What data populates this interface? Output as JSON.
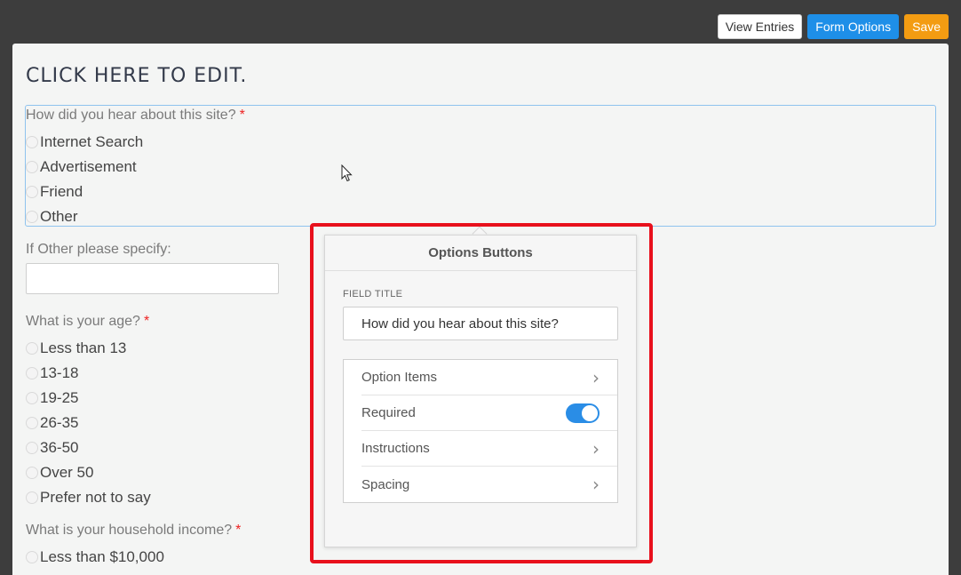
{
  "toolbar": {
    "view_entries": "View Entries",
    "form_options": "Form Options",
    "save": "Save"
  },
  "form": {
    "title": "CLICK HERE TO EDIT.",
    "required_marker": "*",
    "q1": {
      "label": "How did you hear about this site?",
      "options": [
        "Internet Search",
        "Advertisement",
        "Friend",
        "Other"
      ]
    },
    "q2": {
      "label": "If Other please specify:"
    },
    "q3": {
      "label": "What is your age?",
      "options": [
        "Less than 13",
        "13-18",
        "19-25",
        "26-35",
        "36-50",
        "Over 50",
        "Prefer not to say"
      ]
    },
    "q4": {
      "label": "What is your household income?",
      "options": [
        "Less than $10,000"
      ]
    }
  },
  "popover": {
    "title": "Options Buttons",
    "field_title_label": "FIELD TITLE",
    "field_title_value": "How did you hear about this site?",
    "rows": [
      "Option Items",
      "Required",
      "Instructions",
      "Spacing"
    ],
    "chevron": "›"
  },
  "colors": {
    "primary": "#1e8fe8",
    "warning": "#f39c12",
    "highlight": "#e8101c",
    "required": "#ee2222"
  }
}
